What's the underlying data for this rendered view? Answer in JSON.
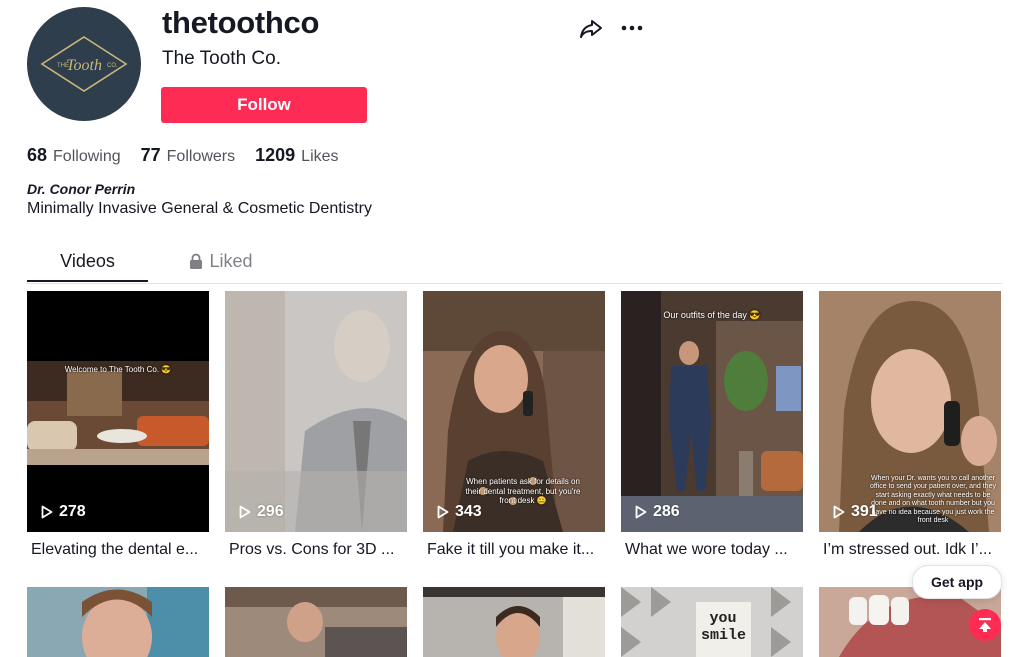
{
  "profile": {
    "username": "thetoothco",
    "display_name": "The Tooth Co.",
    "avatar_text": "THE Tooth CO.",
    "follow_label": "Follow",
    "stats": [
      {
        "number": "68",
        "label": "Following"
      },
      {
        "number": "77",
        "label": "Followers"
      },
      {
        "number": "1209",
        "label": "Likes"
      }
    ],
    "bio_name": "Dr. Conor Perrin",
    "bio_text": "Minimally Invasive General & Cosmetic Dentistry"
  },
  "tabs": [
    {
      "label": "Videos"
    },
    {
      "label": "Liked"
    }
  ],
  "videos": [
    {
      "views": "278",
      "caption": "Elevating the dental e...",
      "overlay": "Welcome to The Tooth Co. 😎"
    },
    {
      "views": "296",
      "caption": "Pros vs. Cons for 3D ...",
      "overlay": ""
    },
    {
      "views": "343",
      "caption": "Fake it till you make it...",
      "overlay": "When patients ask for details on their dental treatment, but you're front desk 🤐"
    },
    {
      "views": "286",
      "caption": "What we wore today ...",
      "overlay": "Our outfits of the day 😎"
    },
    {
      "views": "391",
      "caption": "I’m stressed out. Idk I’...",
      "overlay": "When your Dr. wants you to call another office to send your patient over, and they start asking exactly what needs to be done and on what tooth number but you have no idea because you just work the front desk"
    }
  ],
  "second_row_overlay": "you smile",
  "get_app_label": "Get app",
  "colors": {
    "brand": "#fe2c55",
    "text": "#161823",
    "avatar_bg": "#2e3e4c",
    "logo_gold": "#c9b77a"
  }
}
